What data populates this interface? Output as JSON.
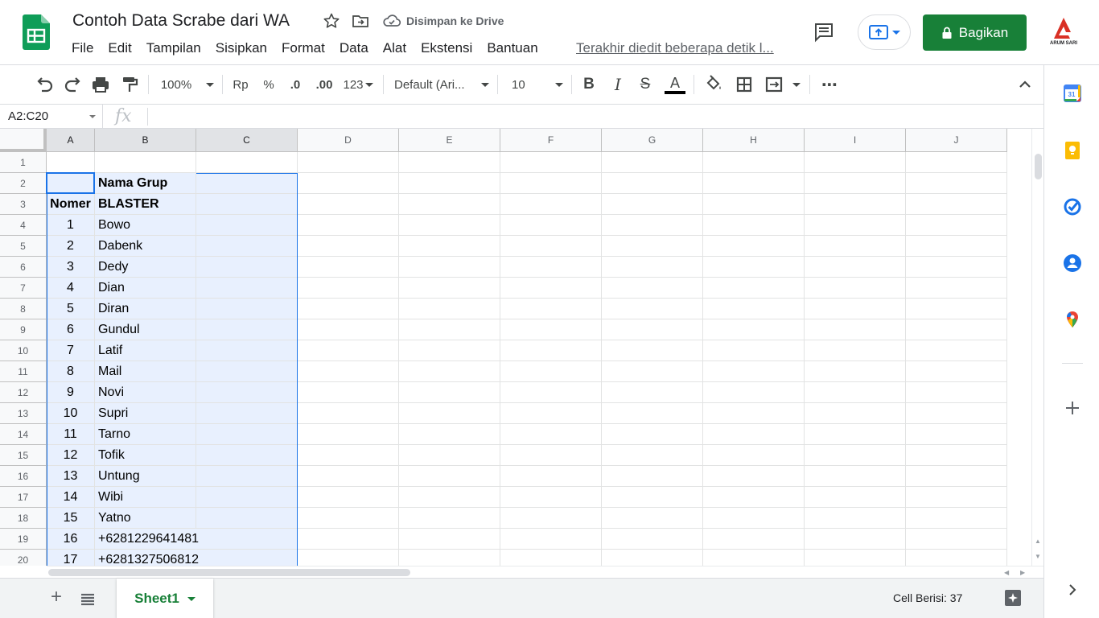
{
  "header": {
    "title": "Contoh Data Scrabe dari WA",
    "save_status": "Disimpan ke Drive",
    "last_edit": "Terakhir diedit beberapa detik l...",
    "share_label": "Bagikan",
    "account_brand": "ARUM SARI"
  },
  "menu": [
    "File",
    "Edit",
    "Tampilan",
    "Sisipkan",
    "Format",
    "Data",
    "Alat",
    "Ekstensi",
    "Bantuan"
  ],
  "toolbar": {
    "zoom": "100%",
    "currency": "Rp",
    "percent": "%",
    "dec_decrease": ".0",
    "dec_increase": ".00",
    "number_format": "123",
    "font": "Default (Ari...",
    "font_size": "10",
    "bold": "B",
    "italic": "I",
    "strike": "S",
    "text_color": "A",
    "more": "⋯"
  },
  "formula_bar": {
    "name_box": "A2:C20",
    "fx": "fx"
  },
  "columns": [
    "A",
    "B",
    "C",
    "D",
    "E",
    "F",
    "G",
    "H",
    "I",
    "J"
  ],
  "rows": [
    {
      "n": "1",
      "a": "",
      "b": ""
    },
    {
      "n": "2",
      "a": "",
      "b": "Nama Grup"
    },
    {
      "n": "3",
      "a": "Nomer",
      "b": "BLASTER"
    },
    {
      "n": "4",
      "a": "1",
      "b": "Bowo"
    },
    {
      "n": "5",
      "a": "2",
      "b": "Dabenk"
    },
    {
      "n": "6",
      "a": "3",
      "b": "Dedy"
    },
    {
      "n": "7",
      "a": "4",
      "b": "Dian"
    },
    {
      "n": "8",
      "a": "5",
      "b": "Diran"
    },
    {
      "n": "9",
      "a": "6",
      "b": "Gundul"
    },
    {
      "n": "10",
      "a": "7",
      "b": "Latif"
    },
    {
      "n": "11",
      "a": "8",
      "b": "Mail"
    },
    {
      "n": "12",
      "a": "9",
      "b": "Novi"
    },
    {
      "n": "13",
      "a": "10",
      "b": "Supri"
    },
    {
      "n": "14",
      "a": "11",
      "b": "Tarno"
    },
    {
      "n": "15",
      "a": "12",
      "b": "Tofik"
    },
    {
      "n": "16",
      "a": "13",
      "b": "Untung"
    },
    {
      "n": "17",
      "a": "14",
      "b": "Wibi"
    },
    {
      "n": "18",
      "a": "15",
      "b": "Yatno"
    },
    {
      "n": "19",
      "a": "16",
      "b": "+6281229641481"
    },
    {
      "n": "20",
      "a": "17",
      "b": "+6281327506812"
    }
  ],
  "bottom": {
    "sheet_name": "Sheet1",
    "status": "Cell Berisi: 37"
  },
  "colors": {
    "brand_green": "#188038",
    "selection_blue": "#1a73e8",
    "selection_fill": "#e8f0fe"
  },
  "side_panel": [
    "calendar-icon",
    "keep-icon",
    "tasks-icon",
    "contacts-icon",
    "maps-icon",
    "add-icon"
  ]
}
